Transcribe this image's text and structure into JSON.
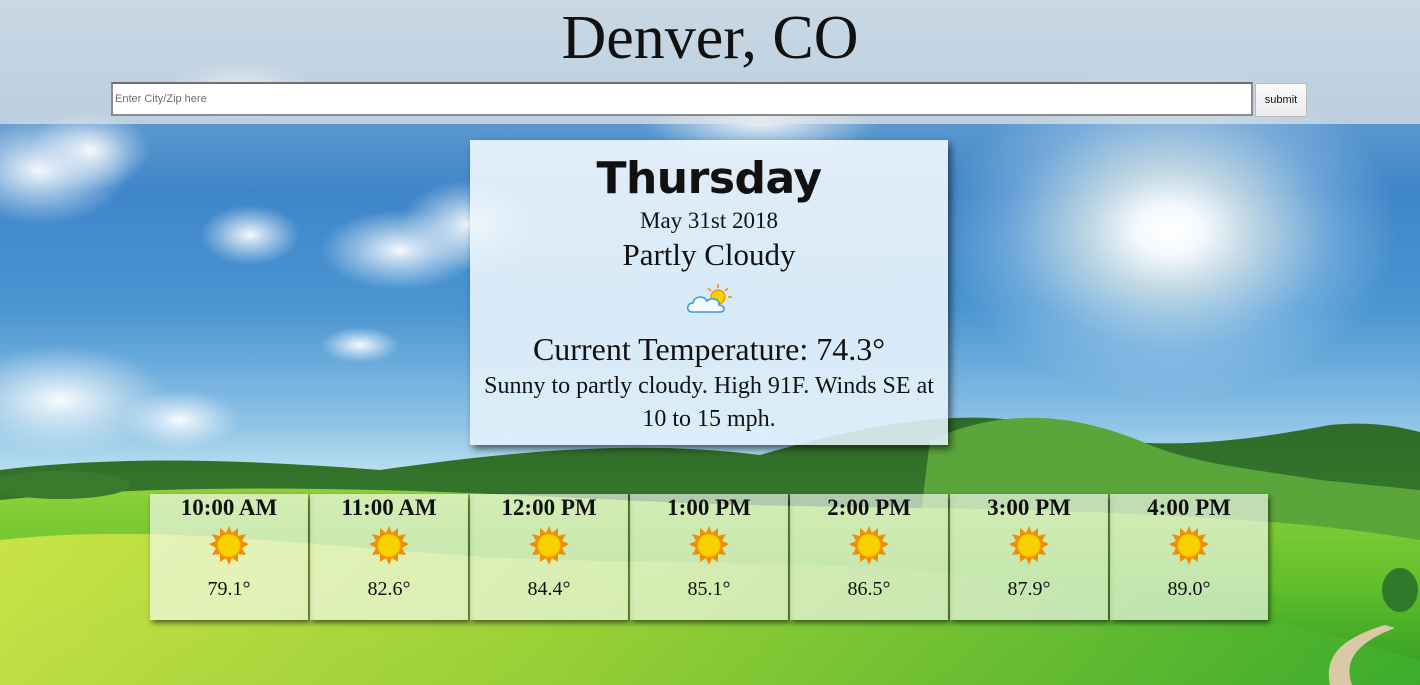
{
  "header": {
    "city": "Denver, CO",
    "search_placeholder": "Enter City/Zip here",
    "search_value": "",
    "submit_label": "submit"
  },
  "today": {
    "day": "Thursday",
    "date": "May 31st 2018",
    "condition": "Partly Cloudy",
    "condition_icon": "partly-cloudy-icon",
    "current_temperature": "Current Temperature: 74.3°",
    "summary": "Sunny to partly cloudy. High 91F. Winds SE at 10 to 15 mph."
  },
  "hourly": [
    {
      "time": "10:00 AM",
      "icon": "sun-icon",
      "temp": "79.1°"
    },
    {
      "time": "11:00 AM",
      "icon": "sun-icon",
      "temp": "82.6°"
    },
    {
      "time": "12:00 PM",
      "icon": "sun-icon",
      "temp": "84.4°"
    },
    {
      "time": "1:00 PM",
      "icon": "sun-icon",
      "temp": "85.1°"
    },
    {
      "time": "2:00 PM",
      "icon": "sun-icon",
      "temp": "86.5°"
    },
    {
      "time": "3:00 PM",
      "icon": "sun-icon",
      "temp": "87.9°"
    },
    {
      "time": "4:00 PM",
      "icon": "sun-icon",
      "temp": "89.0°"
    }
  ],
  "colors": {
    "sky": "#3f86c9",
    "grass": "#5bbf2a",
    "sun_fill": "#f7d200",
    "sun_rays": "#f28c00"
  }
}
